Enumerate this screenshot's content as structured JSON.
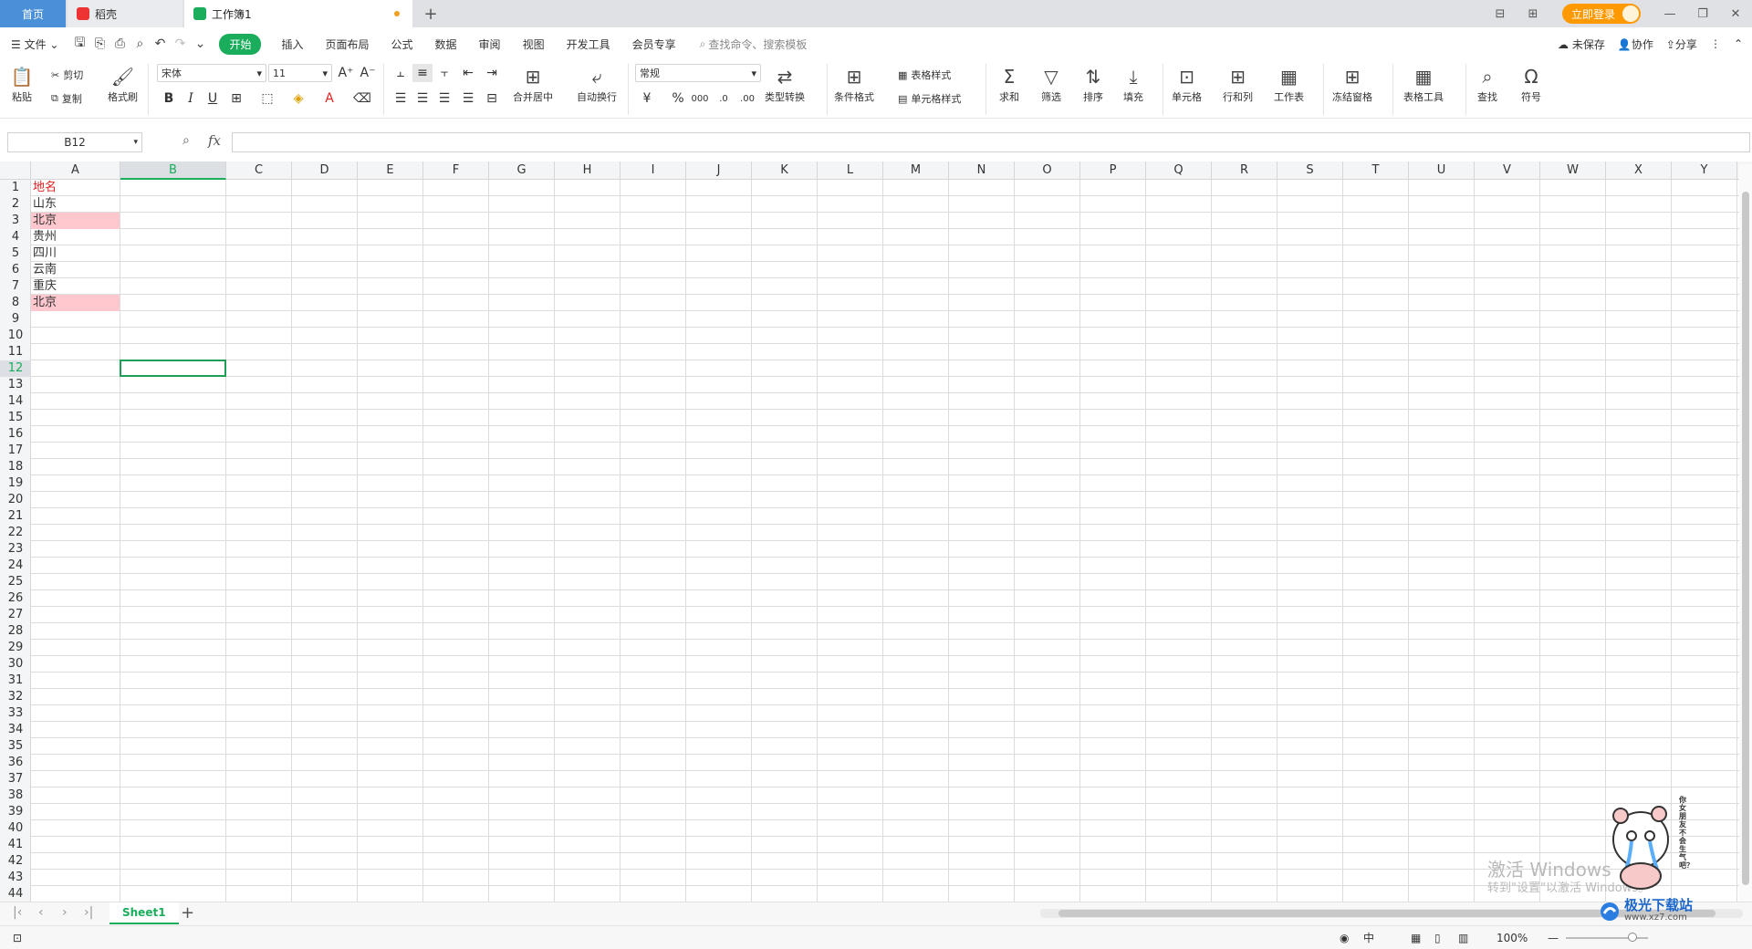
{
  "tabs": {
    "home": "首页",
    "daoke": "稻壳",
    "workbook": "工作簿1",
    "login": "立即登录"
  },
  "menu": {
    "file": "文件",
    "items": [
      "开始",
      "插入",
      "页面布局",
      "公式",
      "数据",
      "审阅",
      "视图",
      "开发工具",
      "会员专享"
    ],
    "search_placeholder": "查找命令、搜索模板",
    "unsaved": "未保存",
    "collab": "协作",
    "share": "分享"
  },
  "ribbon": {
    "paste": "粘贴",
    "cut": "剪切",
    "copy": "复制",
    "format_painter": "格式刷",
    "font_name": "宋体",
    "font_size": "11",
    "merge_center": "合并居中",
    "wrap_text": "自动换行",
    "number_format": "常规",
    "type_convert": "类型转换",
    "cond_format": "条件格式",
    "table_style": "表格样式",
    "cell_style": "单元格样式",
    "sum": "求和",
    "filter": "筛选",
    "sort": "排序",
    "fill": "填充",
    "cell": "单元格",
    "row_col": "行和列",
    "worksheet": "工作表",
    "freeze": "冻结窗格",
    "table_tools": "表格工具",
    "find": "查找",
    "symbol": "符号"
  },
  "formula": {
    "namebox": "B12",
    "fx": "fx",
    "value": ""
  },
  "columns": [
    "A",
    "B",
    "C",
    "D",
    "E",
    "F",
    "G",
    "H",
    "I",
    "J",
    "K",
    "L",
    "M",
    "N",
    "O",
    "P",
    "Q",
    "R",
    "S",
    "T",
    "U",
    "V",
    "W",
    "X",
    "Y"
  ],
  "rows": [
    "1",
    "2",
    "3",
    "4",
    "5",
    "6",
    "7",
    "8",
    "9",
    "10",
    "11",
    "12",
    "13",
    "14",
    "15",
    "16",
    "17",
    "18",
    "19",
    "20",
    "21",
    "22",
    "23",
    "24",
    "25",
    "26",
    "27",
    "28",
    "29",
    "30",
    "31",
    "32",
    "33",
    "34",
    "35",
    "36",
    "37",
    "38",
    "39",
    "40",
    "41",
    "42",
    "43",
    "44"
  ],
  "cells": {
    "A1": "地名",
    "A2": "山东",
    "A3": "北京",
    "A4": "贵州",
    "A5": "四川",
    "A6": "云南",
    "A7": "重庆",
    "A8": "北京"
  },
  "colors": {
    "accent": "#1aad5b",
    "header_text": "#e02020",
    "duplicate_fill": "#ffc7ce",
    "login": "#ff9900"
  },
  "sheetbar": {
    "sheet1": "Sheet1"
  },
  "status": {
    "zoom": "100%"
  },
  "watermark": {
    "line1": "激活 Windows",
    "line2": "转到\"设置\"以激活 Windows。",
    "mascot_text": "你女朋友不会生气吧？",
    "site": "极光下载站",
    "site_url": "www.xz7.com"
  }
}
